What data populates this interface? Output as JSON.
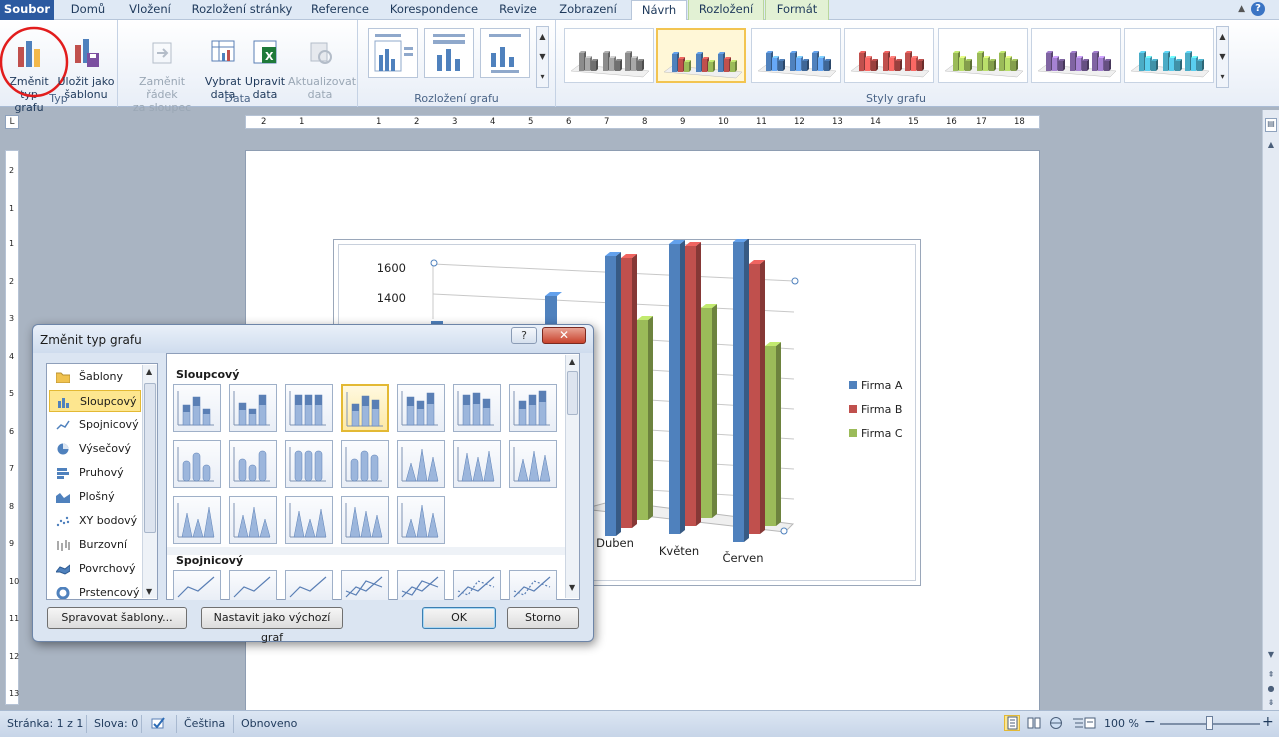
{
  "tabs": [
    "Soubor",
    "Domů",
    "Vložení",
    "Rozložení stránky",
    "Reference",
    "Korespondence",
    "Revize",
    "Zobrazení",
    "Návrh",
    "Rozložení",
    "Formát"
  ],
  "ribbon": {
    "typ": {
      "label": "Typ",
      "change_type": "Změnit\ntyp grafu",
      "save_template": "Uložit jako\nšablonu"
    },
    "data": {
      "label": "Data",
      "switch": "Zaměnit řádek\nza sloupec",
      "select": "Vybrat\ndata",
      "edit": "Upravit\ndata",
      "refresh": "Aktualizovat\ndata"
    },
    "layouts": {
      "label": "Rozložení grafu"
    },
    "styles": {
      "label": "Styly grafu",
      "colors": [
        "#8c8c8c",
        "#4f81bd",
        "#4f81bd",
        "#c0504d",
        "#9bbb59",
        "#8064a2",
        "#4bacc6"
      ]
    }
  },
  "ruler": {
    "h_ticks": [
      "2",
      "1",
      "1",
      "2",
      "3",
      "4",
      "5",
      "6",
      "7",
      "8",
      "9",
      "10",
      "11",
      "12",
      "13",
      "14",
      "15",
      "16",
      "17",
      "18"
    ],
    "v_ticks": [
      "2",
      "1",
      "1",
      "2",
      "3",
      "4",
      "5",
      "6",
      "7",
      "8",
      "9",
      "10",
      "11",
      "12",
      "13"
    ]
  },
  "chart_data": {
    "type": "bar",
    "categories": [
      "Duben",
      "Květen",
      "Červen"
    ],
    "series": [
      {
        "name": "Firma A",
        "color": "#4f81bd",
        "values": [
          1400,
          1450,
          1500
        ]
      },
      {
        "name": "Firma B",
        "color": "#c0504d",
        "values": [
          1350,
          1400,
          1350
        ]
      },
      {
        "name": "Firma C",
        "color": "#9bbb59",
        "values": [
          1000,
          1050,
          900
        ]
      }
    ],
    "y_tick_labels": [
      "1600",
      "1400"
    ],
    "ylim": [
      0,
      1600
    ],
    "legend_position": "right",
    "three_d": true
  },
  "dialog": {
    "title": "Změnit typ grafu",
    "help": "?",
    "close": "✕",
    "types": [
      "Šablony",
      "Sloupcový",
      "Spojnicový",
      "Výsečový",
      "Pruhový",
      "Plošný",
      "XY bodový",
      "Burzovní",
      "Povrchový",
      "Prstencový"
    ],
    "selected_type": "Sloupcový",
    "sections": [
      "Sloupcový",
      "Spojnicový"
    ],
    "buttons": {
      "manage": "Spravovat šablony...",
      "default": "Nastavit jako výchozí graf",
      "ok": "OK",
      "cancel": "Storno"
    }
  },
  "statusbar": {
    "page": "Stránka: 1 z 1",
    "words": "Slova: 0",
    "language": "Čeština",
    "mode": "Obnoveno",
    "zoom": "100 %",
    "zoom_minus": "−",
    "zoom_plus": "+"
  }
}
